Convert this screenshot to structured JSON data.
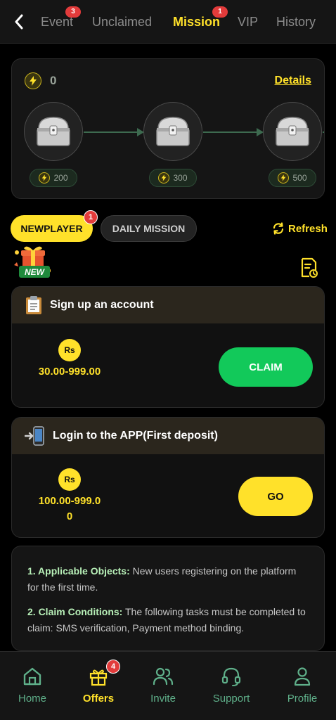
{
  "tabs": [
    {
      "label": "Event",
      "badge": "3"
    },
    {
      "label": "Unclaimed"
    },
    {
      "label": "Mission",
      "badge": "1",
      "active": true
    },
    {
      "label": "VIP"
    },
    {
      "label": "History"
    }
  ],
  "progress": {
    "points": "0",
    "details_label": "Details",
    "chests": [
      {
        "points": "200"
      },
      {
        "points": "300"
      },
      {
        "points": "500"
      }
    ]
  },
  "categories": {
    "newplayer": "NEWPLAYER",
    "newplayer_badge": "1",
    "daily": "DAILY MISSION",
    "refresh": "Refresh",
    "new_tag": "NEW"
  },
  "missions": [
    {
      "title": "Sign up an account",
      "currency": "Rs",
      "reward": "30.00-999.00",
      "action": "CLAIM",
      "icon": "clipboard-icon"
    },
    {
      "title": "Login to the APP(First deposit)",
      "currency": "Rs",
      "reward": "100.00-999.00",
      "action": "GO",
      "icon": "phone-login-icon"
    }
  ],
  "rules": [
    {
      "label": "1. Applicable Objects:",
      "text": "New users registering on the platform for the first time."
    },
    {
      "label": "2. Claim Conditions:",
      "text": "The following tasks must be completed to claim: SMS verification, Payment method binding."
    }
  ],
  "nav": [
    {
      "label": "Home",
      "icon": "home-icon"
    },
    {
      "label": "Offers",
      "icon": "gift-icon",
      "active": true,
      "badge": "4"
    },
    {
      "label": "Invite",
      "icon": "users-icon"
    },
    {
      "label": "Support",
      "icon": "headset-icon"
    },
    {
      "label": "Profile",
      "icon": "person-icon"
    }
  ],
  "colors": {
    "accent": "#ffe12a",
    "claim": "#12c95a",
    "badge": "#e23b3b",
    "nav": "#5fb08a"
  }
}
